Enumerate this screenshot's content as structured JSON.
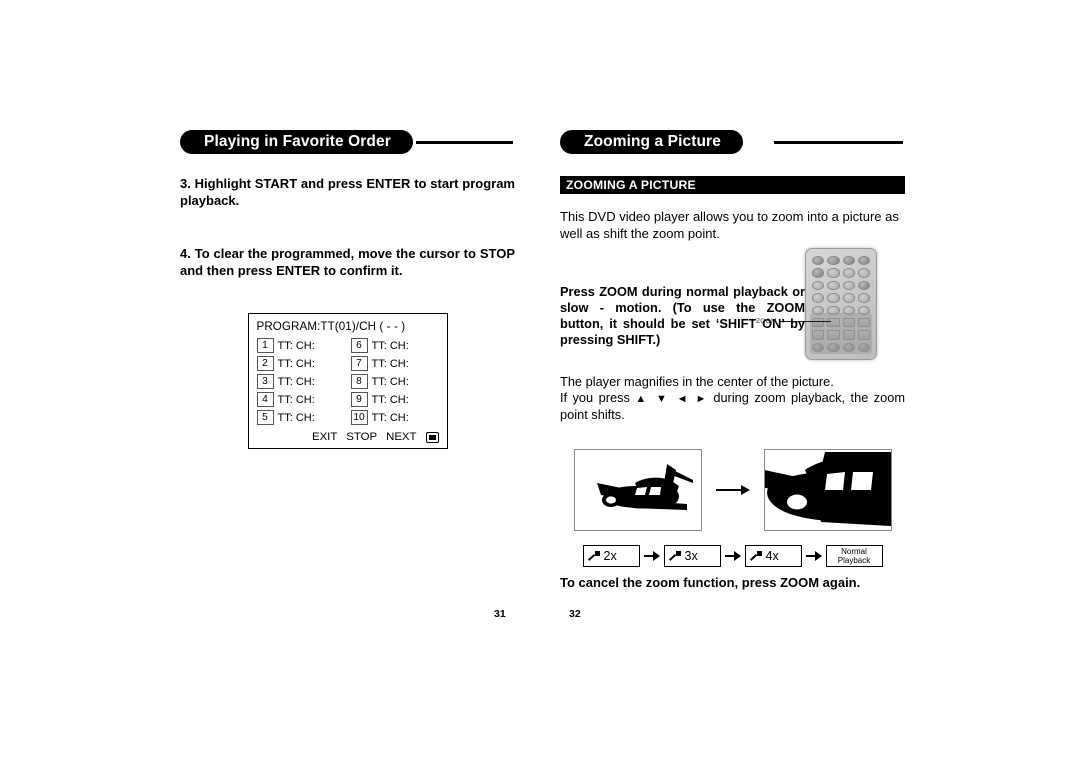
{
  "document": {
    "type": "dvd-player-manual-spread"
  },
  "left_page": {
    "header_title": "Playing in Favorite Order",
    "page_number": "31",
    "steps": [
      {
        "id": "step-3",
        "text": "3. Highlight START and press ENTER to start program playback."
      },
      {
        "id": "step-4",
        "text": "4.  To clear the programmed, move the cursor to STOP and then press ENTER to confirm it."
      }
    ],
    "program_screen": {
      "title": "PROGRAM:TT(01)/CH ( - - )",
      "entries": [
        {
          "number": "1",
          "label": "TT:  CH:"
        },
        {
          "number": "6",
          "label": "TT:  CH:"
        },
        {
          "number": "2",
          "label": "TT:  CH:"
        },
        {
          "number": "7",
          "label": "TT:  CH:"
        },
        {
          "number": "3",
          "label": "TT:  CH:"
        },
        {
          "number": "8",
          "label": "TT:  CH:"
        },
        {
          "number": "4",
          "label": "TT:  CH:"
        },
        {
          "number": "9",
          "label": "TT:  CH:"
        },
        {
          "number": "5",
          "label": "TT:  CH:"
        },
        {
          "number": "10",
          "label": "TT:  CH:"
        }
      ],
      "footer_buttons": [
        "EXIT",
        "STOP",
        "NEXT"
      ],
      "footer_icon": "screen-icon"
    }
  },
  "right_page": {
    "header_title": "Zooming a Picture",
    "page_number": "32",
    "bar_heading": "ZOOMING A PICTURE",
    "intro_text": "This DVD video player allows you to zoom into a picture as well as shift the zoom point.",
    "bold_note": "Press ZOOM during normal playback or slow - motion. (To use the ZOOM button, it should be set ‘SHIFT ON’ by pressing SHIFT.)",
    "remote": {
      "callout_label": "ZOOM"
    },
    "magnify_text_line1": "The player magnifies in the center of the picture.",
    "magnify_text_prefix": "If you press",
    "direction_keys": "▲ ▼ ◄ ►",
    "magnify_text_suffix": "during zoom playback, the zoom point shifts.",
    "figures": {
      "before_alt": "airplane-normal",
      "after_alt": "airplane-zoomed"
    },
    "zoom_steps": [
      {
        "label": "2x",
        "icon": "magnifier-icon"
      },
      {
        "label": "3x",
        "icon": "magnifier-icon"
      },
      {
        "label": "4x",
        "icon": "magnifier-icon"
      }
    ],
    "normal_playback": {
      "line1": "Normal",
      "line2": "Playback"
    },
    "cancel_text": "To cancel the zoom function, press ZOOM again."
  }
}
